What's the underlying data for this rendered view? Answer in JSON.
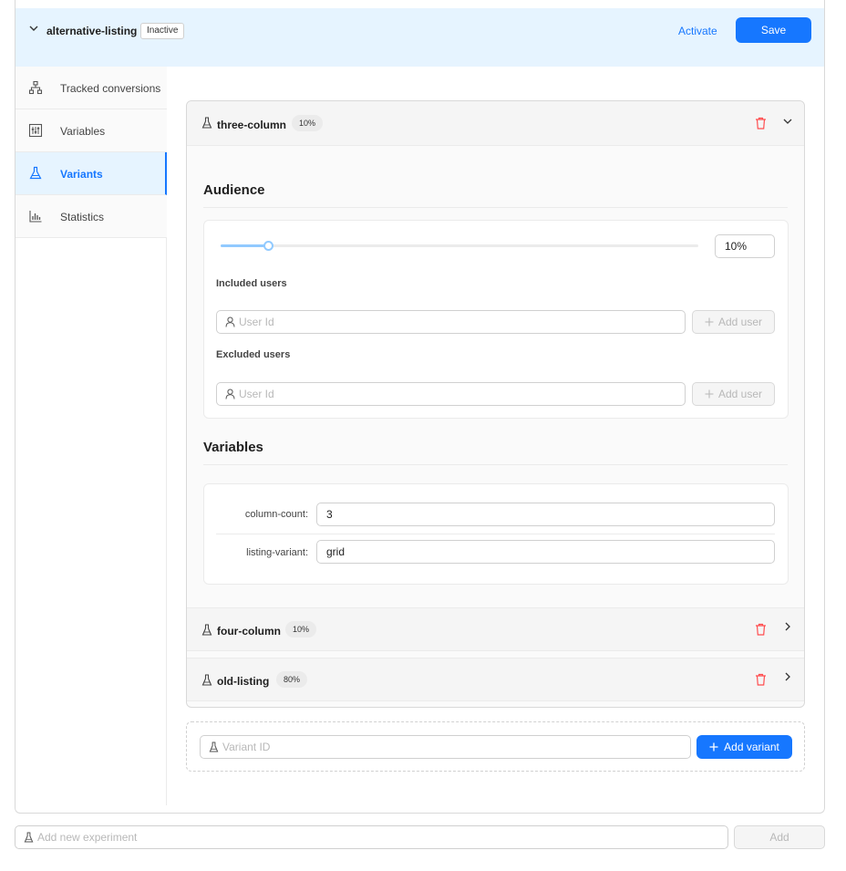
{
  "experiment": {
    "name": "alternative-listing",
    "status": "Inactive",
    "activate_label": "Activate",
    "save_label": "Save"
  },
  "sidebar": {
    "items": [
      {
        "label": "Tracked conversions",
        "icon": "sitemap-icon"
      },
      {
        "label": "Variables",
        "icon": "sliders-icon"
      },
      {
        "label": "Variants",
        "icon": "flask-icon",
        "active": true
      },
      {
        "label": "Statistics",
        "icon": "bar-chart-icon"
      }
    ]
  },
  "variants": [
    {
      "name": "three-column",
      "percent": "10%",
      "expanded": true,
      "audience": {
        "title": "Audience",
        "slider_value": 10,
        "percent_input": "10%",
        "included_label": "Included users",
        "excluded_label": "Excluded users",
        "user_placeholder": "User Id",
        "add_user_label": "Add user"
      },
      "variables": {
        "title": "Variables",
        "rows": [
          {
            "key": "column-count:",
            "value": "3"
          },
          {
            "key": "listing-variant:",
            "value": "grid"
          }
        ]
      }
    },
    {
      "name": "four-column",
      "percent": "10%",
      "expanded": false
    },
    {
      "name": "old-listing",
      "percent": "80%",
      "expanded": false
    }
  ],
  "add_variant": {
    "placeholder": "Variant ID",
    "button_label": "Add variant"
  },
  "new_experiment": {
    "placeholder": "Add new experiment",
    "button_label": "Add"
  },
  "colors": {
    "accent": "#1677ff",
    "header_bg": "#e6f4ff",
    "danger": "#ff4d4f"
  }
}
